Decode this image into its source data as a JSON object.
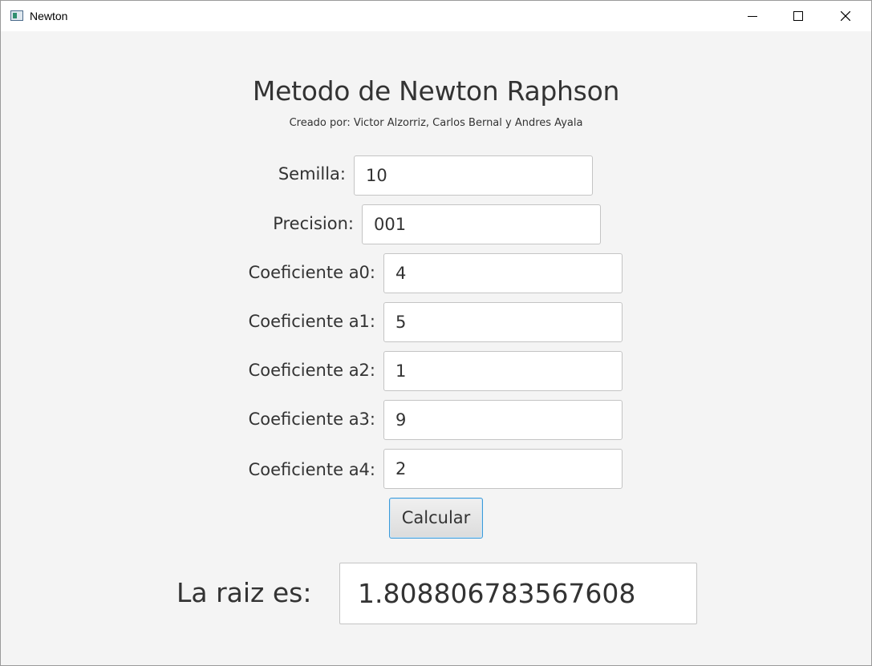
{
  "window": {
    "title": "Newton",
    "icon": "app-window-icon",
    "controls": [
      "minimize-icon",
      "maximize-icon",
      "close-icon"
    ]
  },
  "header": {
    "title": "Metodo de Newton Raphson",
    "subtitle": "Creado por: Victor Alzorriz, Carlos Bernal y Andres Ayala"
  },
  "form": {
    "fields": [
      {
        "label": "Semilla:",
        "value": "10"
      },
      {
        "label": "Precision:",
        "value": "001"
      },
      {
        "label": "Coeficiente a0:",
        "value": "4"
      },
      {
        "label": "Coeficiente a1:",
        "value": "5"
      },
      {
        "label": "Coeficiente a2:",
        "value": "1"
      },
      {
        "label": "Coeficiente a3:",
        "value": "9"
      },
      {
        "label": "Coeficiente a4:",
        "value": "2"
      }
    ],
    "calculate_label": "Calcular"
  },
  "result": {
    "label": "La raiz es:",
    "value": "1.808806783567608"
  },
  "colors": {
    "background": "#f4f4f4",
    "text": "#333333",
    "focus_border": "#3b9ad9"
  }
}
